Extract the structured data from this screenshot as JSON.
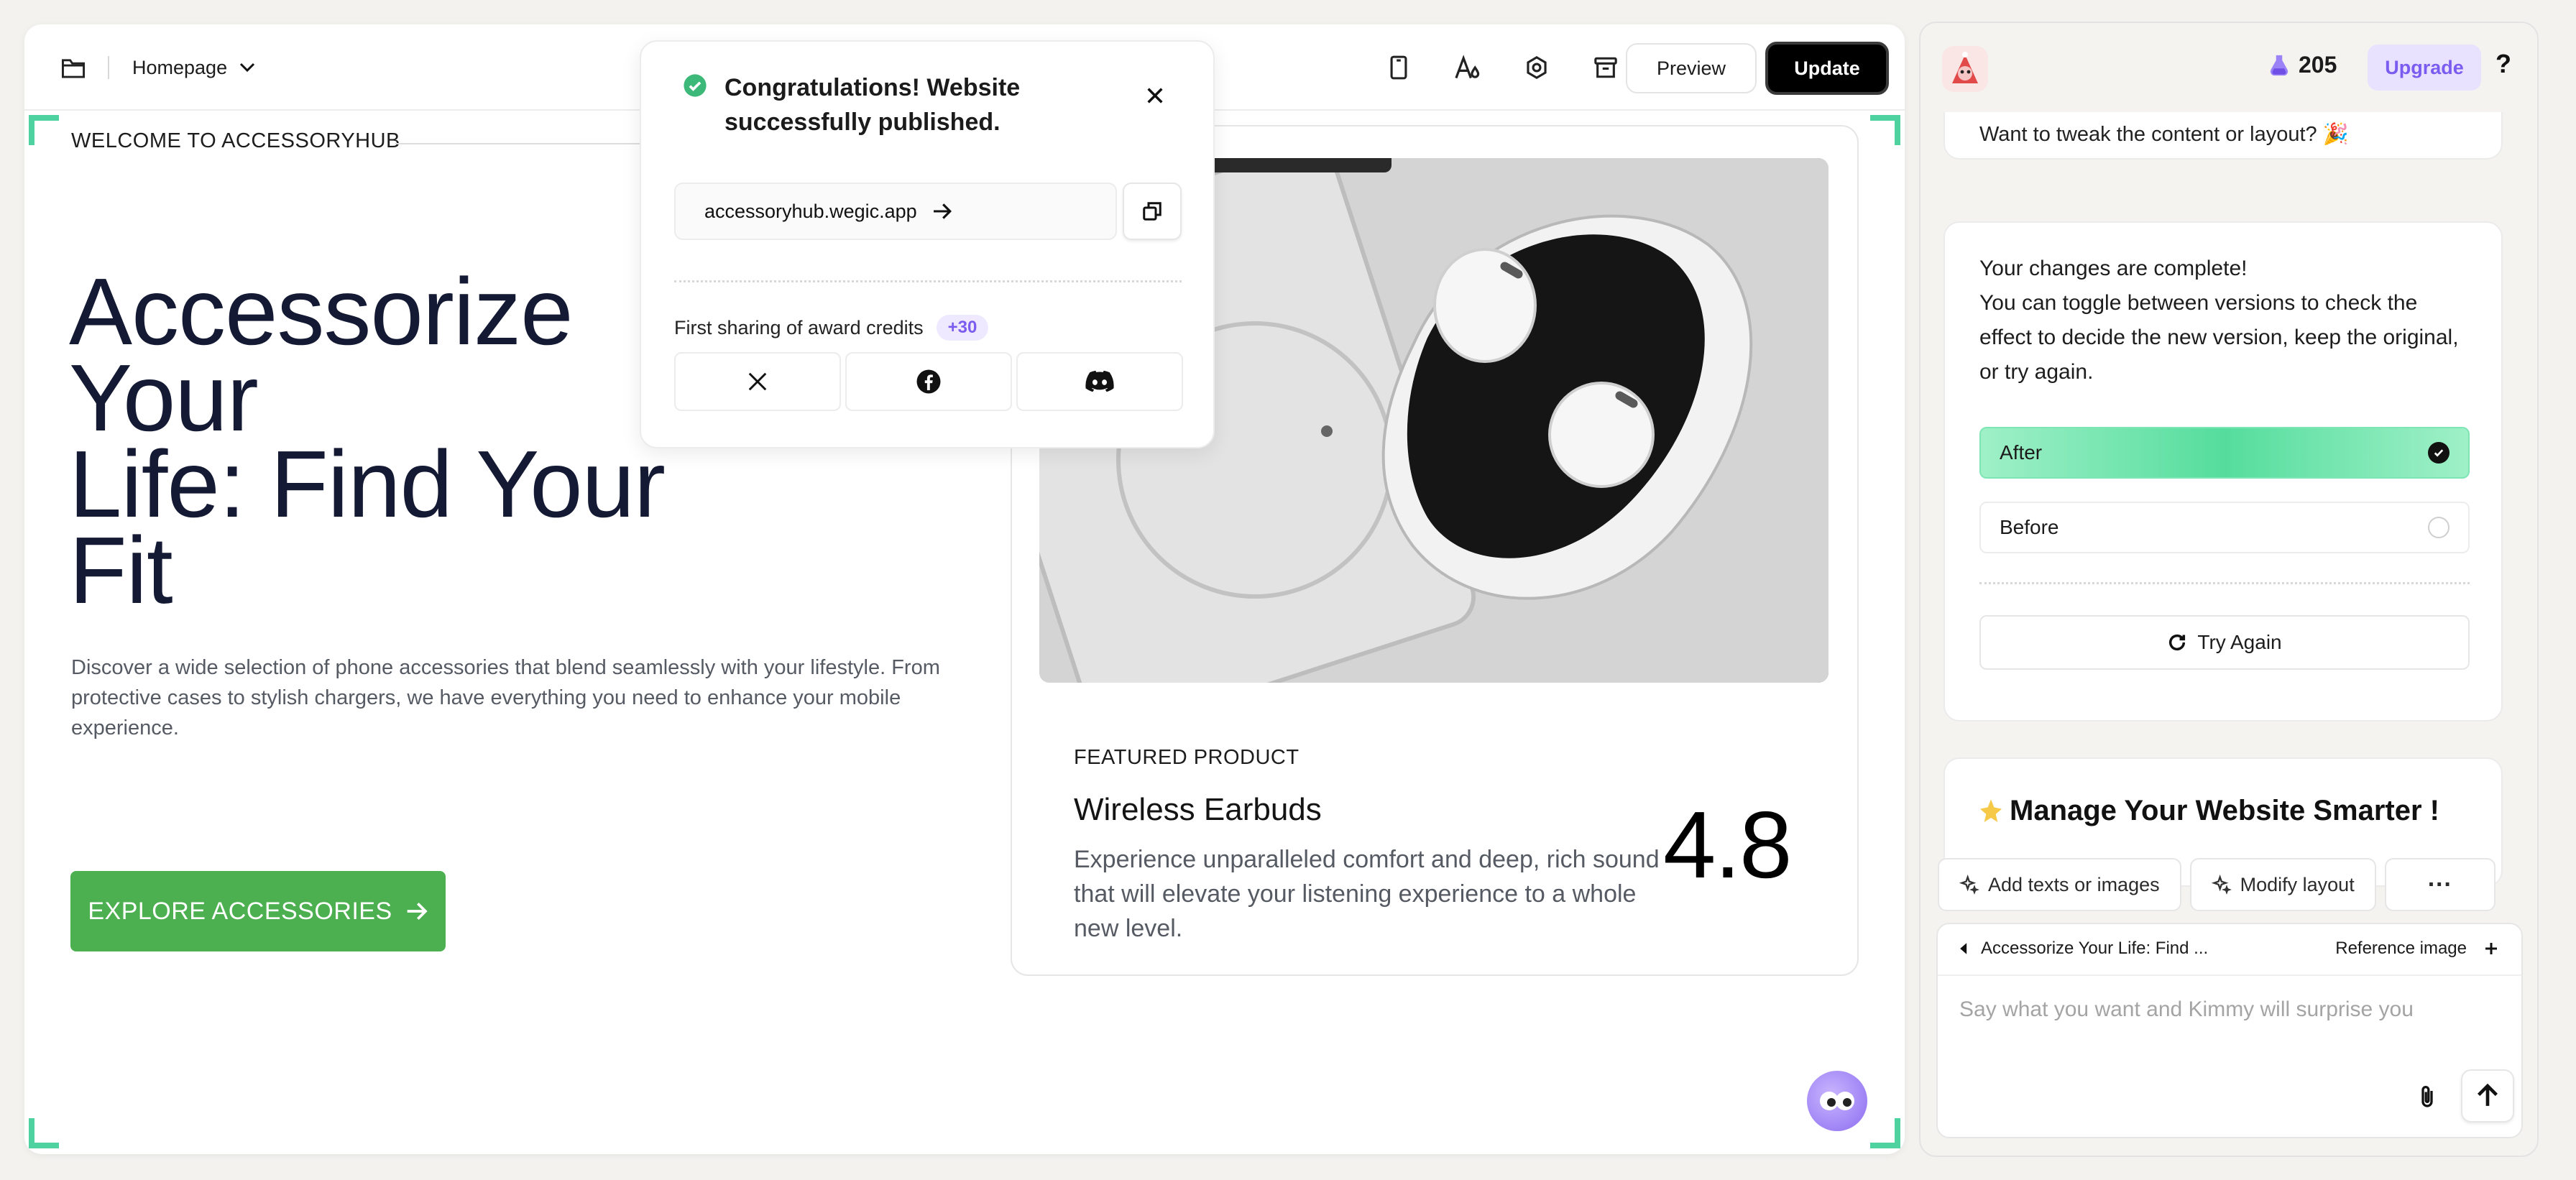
{
  "toolbar": {
    "page_name": "Homepage",
    "preview_label": "Preview",
    "update_label": "Update",
    "icons": [
      "folder-icon",
      "chevron-down-icon",
      "mobile-icon",
      "font-style-icon",
      "settings-icon",
      "archive-icon"
    ]
  },
  "hero": {
    "welcome": "WELCOME TO ACCESSORYHUB",
    "title_line1": "Accessorize Your",
    "title_line2": "Life: Find Your",
    "title_line3": "Fit",
    "description": "Discover a wide selection of phone accessories that blend seamlessly with your lifestyle. From protective cases to stylish chargers, we have everything you need to enhance your mobile experience.",
    "cta_label": "EXPLORE ACCESSORIES"
  },
  "featured": {
    "label": "FEATURED PRODUCT",
    "name": "Wireless Earbuds",
    "description": "Experience unparalleled comfort and deep, rich sound that will elevate your listening experience to a whole new level.",
    "rating": "4.8"
  },
  "popup": {
    "title": "Congratulations! Website successfully published.",
    "url": "accessoryhub.wegic.app",
    "share_text": "First sharing of award credits",
    "share_badge": "+30",
    "social": [
      "x-icon",
      "facebook-icon",
      "discord-icon"
    ]
  },
  "panel": {
    "credits": "205",
    "upgrade_label": "Upgrade",
    "help_label": "?",
    "msg1_text": "Want to tweak the content or layout? 🎉",
    "msg2_text": "Your changes are complete!\nYou can toggle between versions to check the effect to decide the new version, keep the original, or try again.",
    "option_after": "After",
    "option_before": "Before",
    "try_again": "Try Again",
    "msg3_text": "Manage Your Website Smarter !",
    "chip_add": "Add texts or images",
    "chip_modify": "Modify layout",
    "chip_more": "···",
    "composer_ref": "Accessorize Your Life: Find ...",
    "composer_ref_image": "Reference image",
    "composer_placeholder": "Say what you want and Kimmy will surprise you"
  },
  "colors": {
    "accent_green": "#4caf50",
    "corner_green": "#4ed3a0",
    "after_green": "#55dd9d",
    "purple": "#7b5cf0",
    "title_navy": "#141a33"
  }
}
